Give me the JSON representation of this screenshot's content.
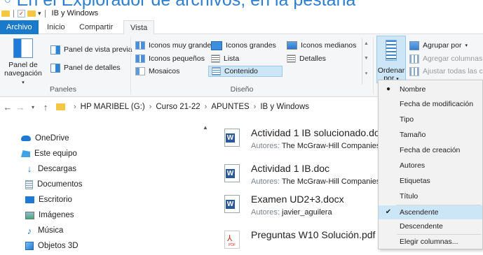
{
  "caption": {
    "text": "En el Explorador de archivos, en la pestaña"
  },
  "titlebar": {
    "title": "IB y Windows"
  },
  "tabs": [
    {
      "label": "Archivo"
    },
    {
      "label": "Inicio"
    },
    {
      "label": "Compartir"
    },
    {
      "label": "Vista"
    }
  ],
  "ribbon": {
    "paneles": {
      "nav_pane_line1": "Panel de",
      "nav_pane_line2": "navegación",
      "preview_pane": "Panel de vista previa",
      "details_pane": "Panel de detalles",
      "group_label": "Paneles"
    },
    "diseno": {
      "extra_large": "Iconos muy grandes",
      "large": "Iconos grandes",
      "medium": "Iconos medianos",
      "small": "Iconos pequeños",
      "list": "Lista",
      "details": "Detalles",
      "tiles": "Mosaicos",
      "content": "Contenido",
      "group_label": "Diseño"
    },
    "vista_actual": {
      "sort_line1": "Ordenar",
      "sort_line2": "por",
      "group_by": "Agrupar por",
      "add_columns": "Agregar columnas",
      "fit_columns": "Ajustar todas las colu"
    }
  },
  "addressbar": {
    "path": [
      "HP MARIBEL (G:)",
      "Curso 21-22",
      "APUNTES",
      "IB y Windows"
    ]
  },
  "navpane": {
    "items": [
      {
        "label": "OneDrive",
        "icon": "onedrive-icon"
      },
      {
        "label": "Este equipo",
        "icon": "this-pc-icon"
      },
      {
        "label": "Descargas",
        "icon": "downloads-icon"
      },
      {
        "label": "Documentos",
        "icon": "documents-icon"
      },
      {
        "label": "Escritorio",
        "icon": "desktop-icon"
      },
      {
        "label": "Imágenes",
        "icon": "pictures-icon"
      },
      {
        "label": "Música",
        "icon": "music-icon"
      },
      {
        "label": "Objetos 3D",
        "icon": "3d-objects-icon"
      }
    ]
  },
  "files": [
    {
      "name": "Actividad 1 IB solucionado.doc",
      "meta_label": "Autores:",
      "meta_value": "The McGraw-Hill Companies",
      "type": "word"
    },
    {
      "name": "Actividad 1 IB.doc",
      "meta_label": "Autores:",
      "meta_value": "The McGraw-Hill Companies",
      "type": "word"
    },
    {
      "name": "Examen UD2+3.docx",
      "meta_label": "Autores:",
      "meta_value": "javier_aguilera",
      "type": "word"
    },
    {
      "name": "Preguntas W10 Solución.pdf",
      "meta_label": "",
      "meta_value": "",
      "type": "pdf"
    }
  ],
  "sort_menu": {
    "items": [
      {
        "label": "Nombre",
        "mark": "●"
      },
      {
        "label": "Fecha de modificación",
        "mark": ""
      },
      {
        "label": "Tipo",
        "mark": ""
      },
      {
        "label": "Tamaño",
        "mark": ""
      },
      {
        "label": "Fecha de creación",
        "mark": ""
      },
      {
        "label": "Autores",
        "mark": ""
      },
      {
        "label": "Etiquetas",
        "mark": ""
      },
      {
        "label": "Título",
        "mark": ""
      },
      {
        "label": "Ascendente",
        "mark": "✔"
      },
      {
        "label": "Descendente",
        "mark": ""
      },
      {
        "label": "Elegir columnas...",
        "mark": ""
      }
    ]
  },
  "colors": {
    "accent": "#1979ca",
    "selection": "#cde6f7",
    "folder": "#f5c544"
  }
}
